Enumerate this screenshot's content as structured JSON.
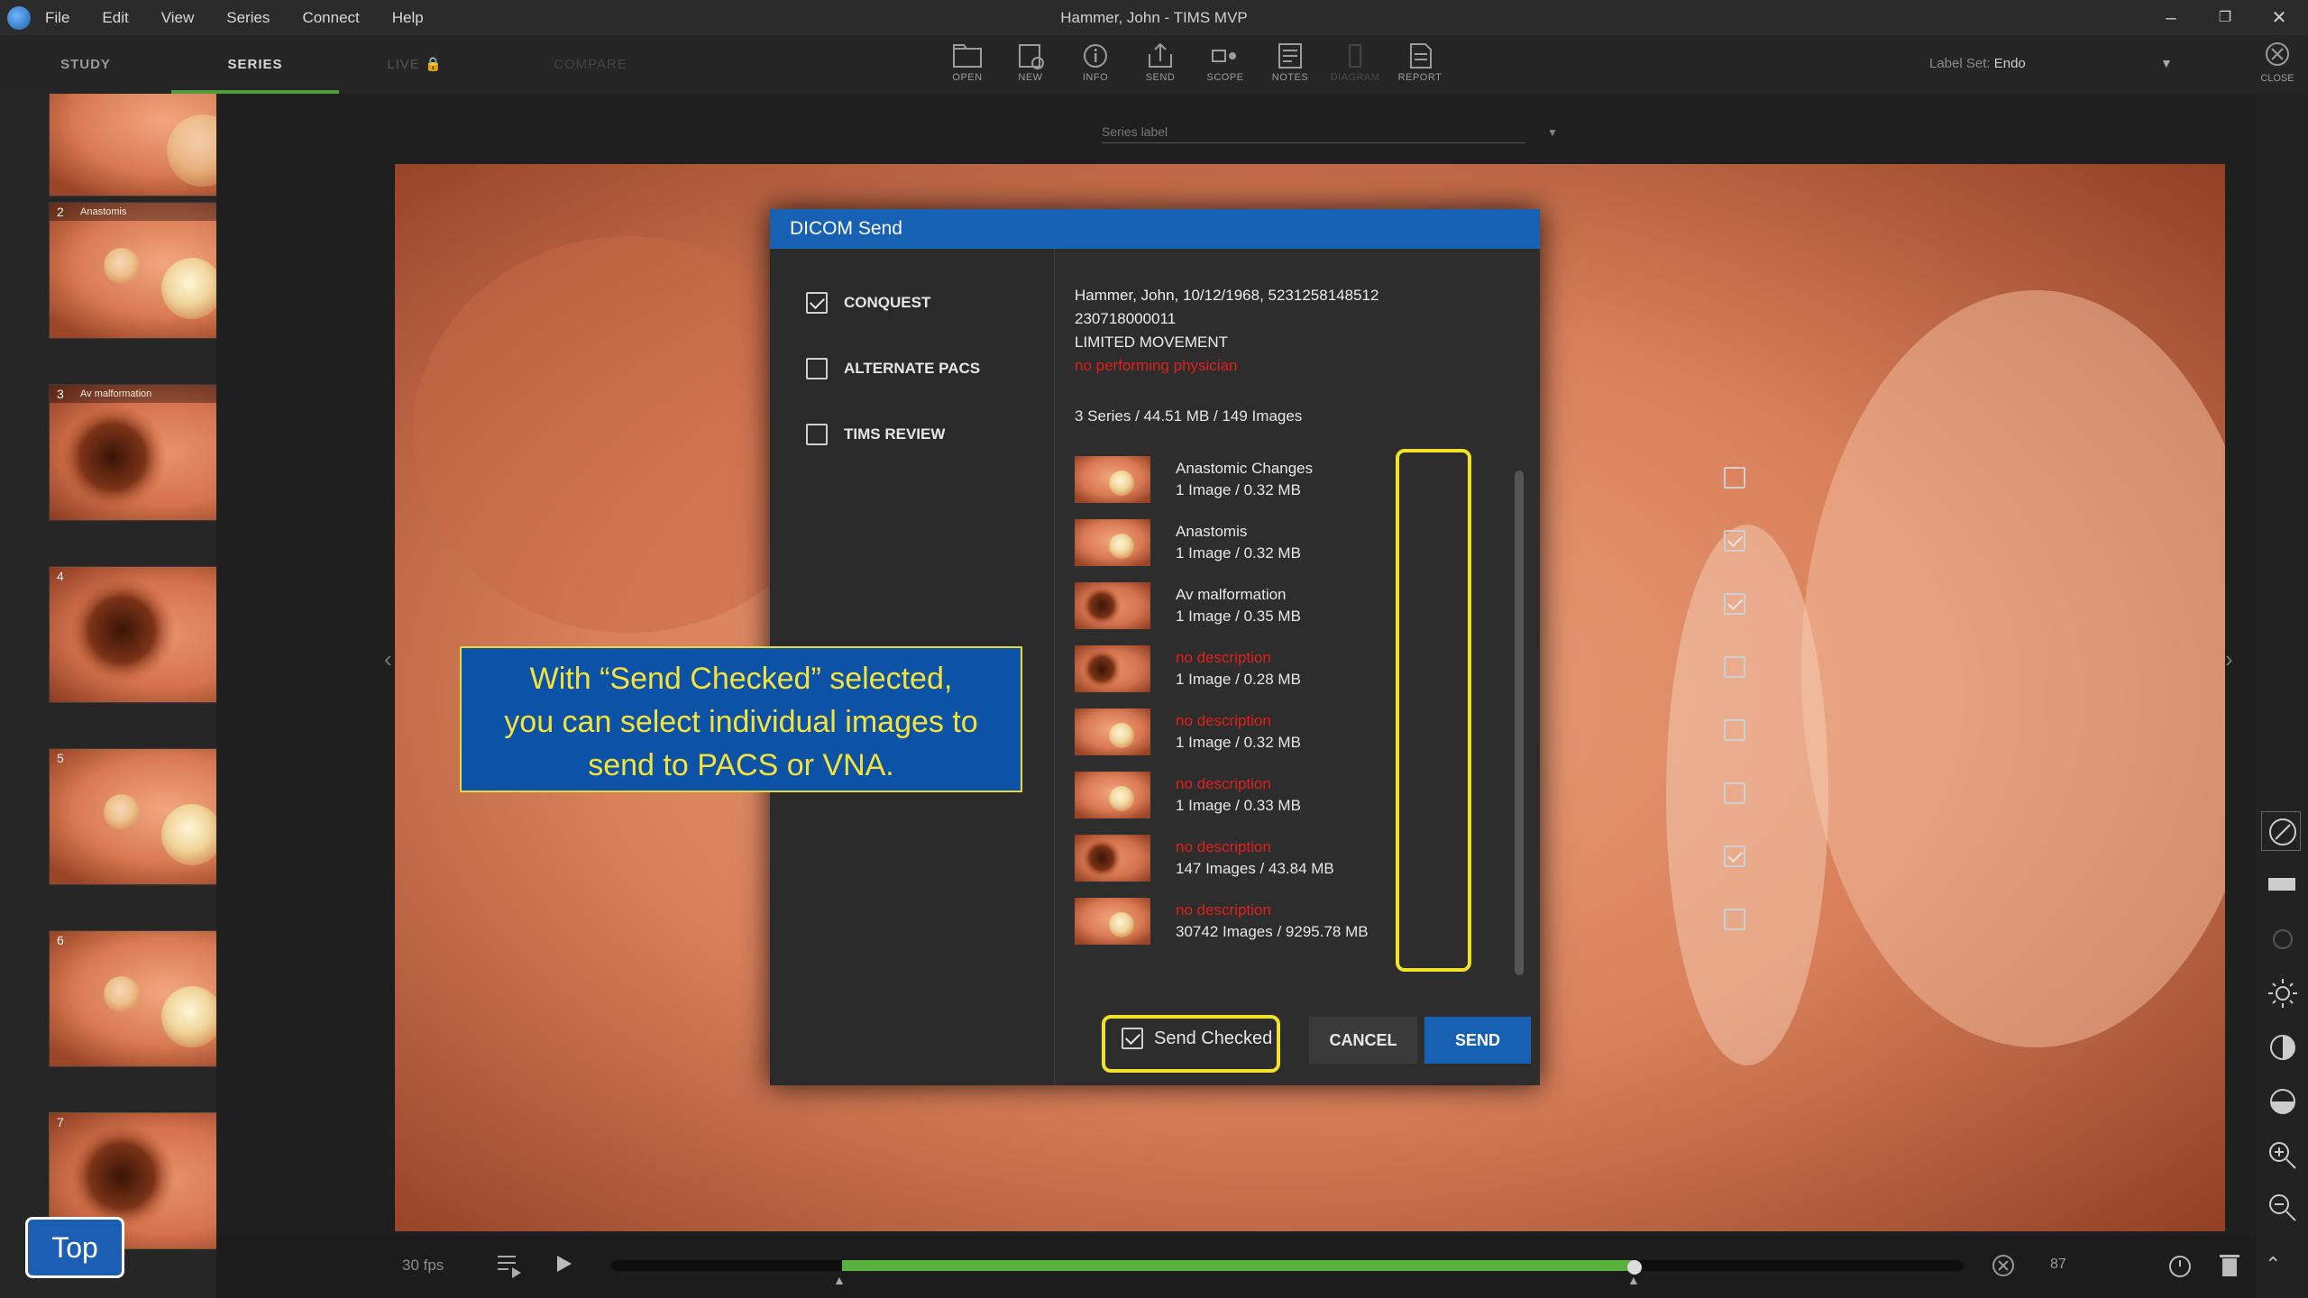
{
  "window": {
    "title": "Hammer, John - TIMS MVP",
    "menu": [
      "File",
      "Edit",
      "View",
      "Series",
      "Connect",
      "Help"
    ]
  },
  "tabs": {
    "study": "STUDY",
    "series": "SERIES",
    "live": "LIVE",
    "compare": "COMPARE"
  },
  "toolbar": {
    "buttons": [
      "OPEN",
      "NEW",
      "INFO",
      "SEND",
      "SCOPE",
      "NOTES",
      "DIAGRAM",
      "REPORT"
    ],
    "label_set_prefix": "Label Set:",
    "label_set_value": "Endo",
    "close": "CLOSE"
  },
  "viewer": {
    "series_label_placeholder": "Series label"
  },
  "sidebar": {
    "thumbnails": [
      {
        "num": "",
        "name": ""
      },
      {
        "num": "2",
        "name": "Anastomis"
      },
      {
        "num": "3",
        "name": "Av malformation"
      },
      {
        "num": "4",
        "name": ""
      },
      {
        "num": "5",
        "name": ""
      },
      {
        "num": "6",
        "name": ""
      },
      {
        "num": "7",
        "name": ""
      }
    ]
  },
  "dialog": {
    "title": "DICOM Send",
    "destinations": [
      {
        "label": "CONQUEST",
        "checked": true
      },
      {
        "label": "ALTERNATE PACS",
        "checked": false
      },
      {
        "label": "TIMS REVIEW",
        "checked": false
      }
    ],
    "patient_line": "Hammer, John, 10/12/1968, 5231258148512",
    "accession": "230718000011",
    "procedure": "LIMITED MOVEMENT",
    "physician_warning": "no performing physician",
    "summary": "3 Series / 44.51 MB / 149 Images",
    "series": [
      {
        "name": "Anastomic Changes",
        "size": "1 Image / 0.32 MB",
        "checked": false,
        "nodesc": false
      },
      {
        "name": "Anastomis",
        "size": "1 Image / 0.32 MB",
        "checked": true,
        "nodesc": false
      },
      {
        "name": "Av malformation",
        "size": "1 Image / 0.35 MB",
        "checked": true,
        "nodesc": false
      },
      {
        "name": "no description",
        "size": "1 Image / 0.28 MB",
        "checked": false,
        "nodesc": true
      },
      {
        "name": "no description",
        "size": "1 Image / 0.32 MB",
        "checked": false,
        "nodesc": true
      },
      {
        "name": "no description",
        "size": "1 Image / 0.33 MB",
        "checked": false,
        "nodesc": true
      },
      {
        "name": "no description",
        "size": "147 Images / 43.84 MB",
        "checked": true,
        "nodesc": true
      },
      {
        "name": "no description",
        "size": "30742 Images / 9295.78 MB",
        "checked": false,
        "nodesc": true
      }
    ],
    "send_checked_label": "Send Checked",
    "send_checked": true,
    "cancel": "CANCEL",
    "send": "SEND"
  },
  "callout": {
    "line1": "With “Send Checked” selected,",
    "line2": "you can select individual images to",
    "line3": "send to PACS or VNA."
  },
  "bottom": {
    "fps": "30 fps",
    "frame": "87",
    "playback_progress_start": 0.17,
    "playback_progress_end": 0.76
  },
  "top_button": "Top",
  "colors": {
    "accent_blue": "#1761b5",
    "highlight_yellow": "#f0e12a",
    "progress_green": "#56b23c",
    "warning_red": "#e0201c"
  }
}
